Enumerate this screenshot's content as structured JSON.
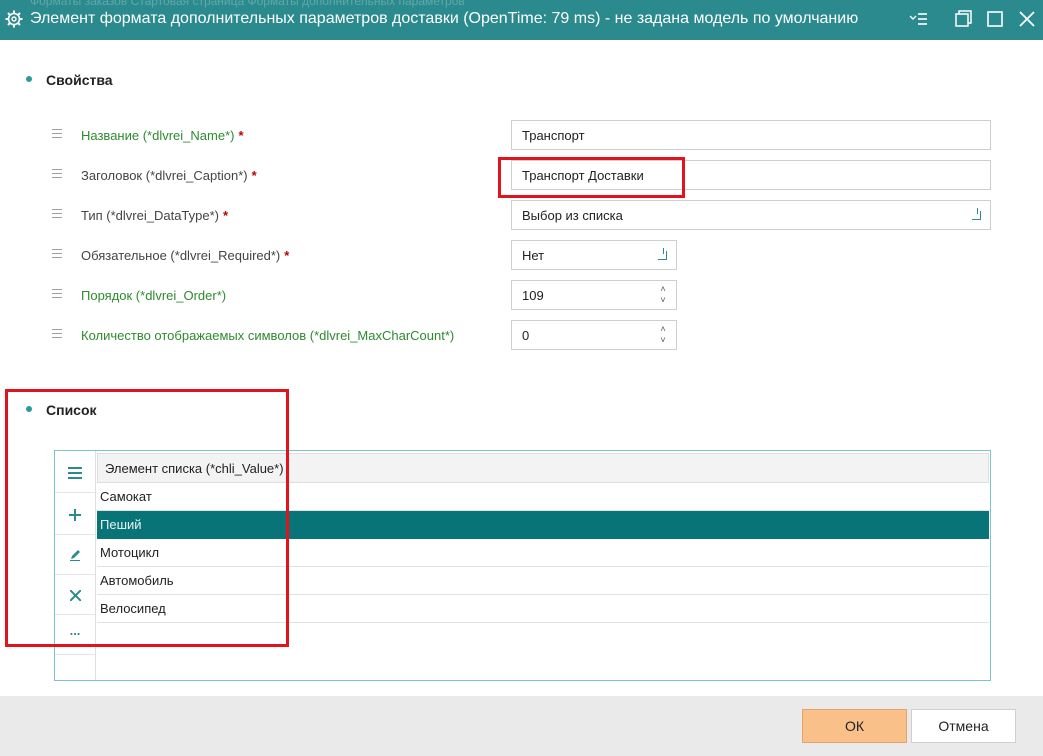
{
  "window": {
    "title": "Элемент формата дополнительных параметров доставки (OpenTime: 79 ms) - не задана модель по умолчанию",
    "ghost_tabs": "Форматы заказов    Стартовая страница    Форматы дополнительных параметров"
  },
  "properties": {
    "heading": "Свойства",
    "rows": [
      {
        "label": "Название (*dlvrei_Name*)",
        "required": "*",
        "value": "Транспорт"
      },
      {
        "label": "Заголовок (*dlvrei_Caption*)",
        "required": "*",
        "value": "Транспорт Доставки"
      },
      {
        "label": "Тип (*dlvrei_DataType*)",
        "required": "*",
        "value": "Выбор из списка"
      },
      {
        "label": "Обязательное (*dlvrei_Required*)",
        "required": "*",
        "value": "Нет"
      },
      {
        "label": "Порядок (*dlvrei_Order*)",
        "required": "",
        "value": "109"
      },
      {
        "label": "Количество отображаемых символов (*dlvrei_MaxCharCount*)",
        "required": "",
        "value": "0"
      }
    ]
  },
  "list": {
    "heading": "Список",
    "column_header": "Элемент списка (*chli_Value*)",
    "items": [
      "Самокат",
      "Пеший",
      "Мотоцикл",
      "Автомобиль",
      "Велосипед"
    ],
    "selected_index": 1,
    "toolbar_icons": [
      "menu-icon",
      "add-icon",
      "edit-icon",
      "delete-icon",
      "more-icon"
    ],
    "more_label": "..."
  },
  "footer": {
    "ok_label": "ОК",
    "cancel_label": "Отмена"
  },
  "colors": {
    "titlebar": "#2b8a8d",
    "selected_row": "#087478",
    "ok_button": "#f9c08a",
    "highlight": "#e3131d",
    "green_label": "#2f8a2f"
  }
}
